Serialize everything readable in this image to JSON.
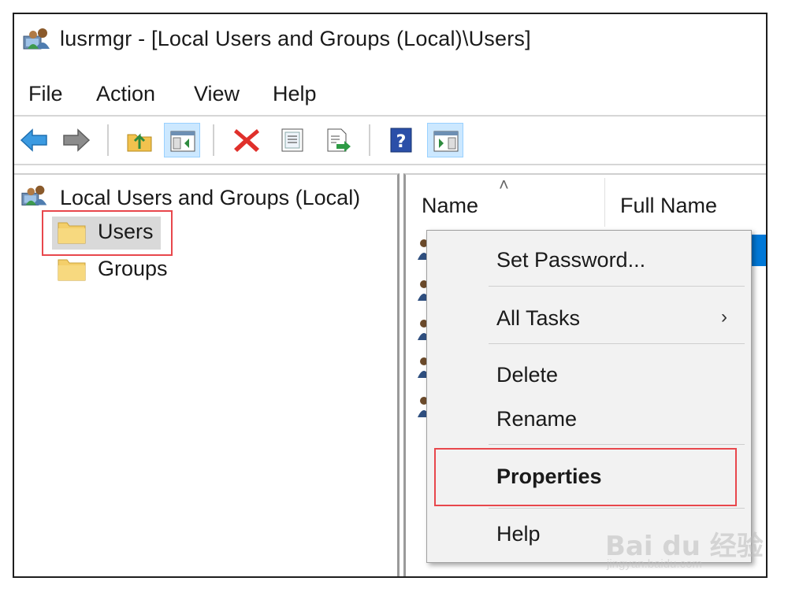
{
  "window": {
    "title": "lusrmgr - [Local Users and Groups (Local)\\Users]",
    "icon": "users-console-icon"
  },
  "menu": [
    "File",
    "Action",
    "View",
    "Help"
  ],
  "toolbar": {
    "buttons": [
      {
        "name": "back-arrow-icon"
      },
      {
        "name": "forward-arrow-icon"
      },
      {
        "name": "up-folder-icon"
      },
      {
        "name": "show-hide-tree-icon",
        "pressed": true
      },
      {
        "name": "delete-icon"
      },
      {
        "name": "properties-icon"
      },
      {
        "name": "export-list-icon"
      },
      {
        "name": "help-icon"
      },
      {
        "name": "show-hide-action-pane-icon",
        "pressed": true
      }
    ]
  },
  "tree": {
    "root": "Local Users and Groups (Local)",
    "nodes": [
      {
        "label": "Users",
        "selected": true
      },
      {
        "label": "Groups",
        "selected": false
      }
    ]
  },
  "list": {
    "columns": [
      "Name",
      "Full Name"
    ]
  },
  "context_menu": {
    "items": [
      "Set Password...",
      "All Tasks",
      "Delete",
      "Rename",
      "Properties",
      "Help"
    ]
  },
  "watermark": {
    "brand": "Bai du 经验",
    "url": "jingyan.baidu.com"
  },
  "colors": {
    "selection": "#0078d7",
    "highlight_box": "#e8474c",
    "menu_bg": "#f2f2f2"
  }
}
